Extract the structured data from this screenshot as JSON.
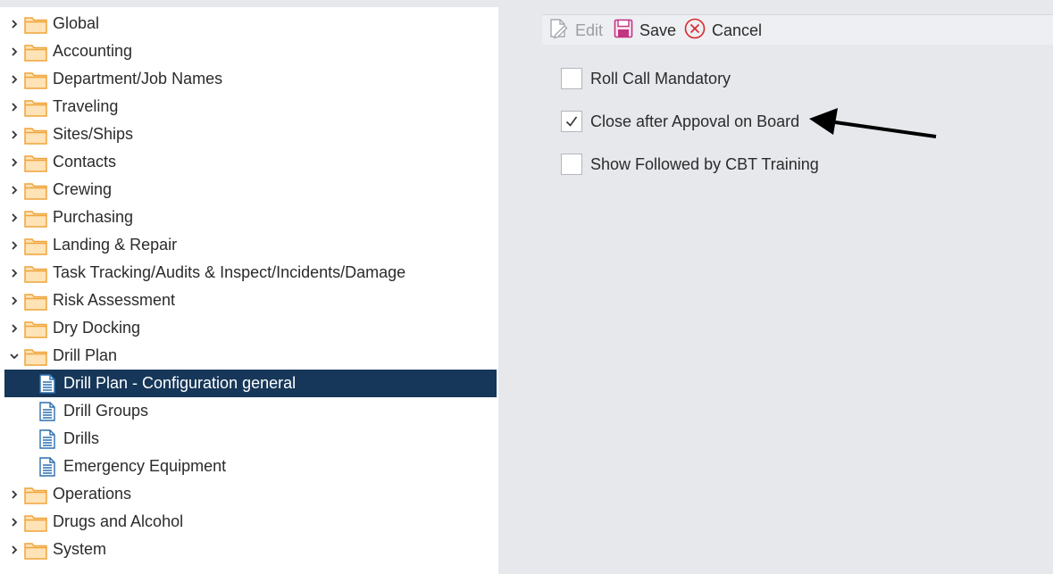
{
  "tree": {
    "items": [
      {
        "label": "Global",
        "type": "folder",
        "expanded": false,
        "level": 0
      },
      {
        "label": "Accounting",
        "type": "folder",
        "expanded": false,
        "level": 0
      },
      {
        "label": "Department/Job Names",
        "type": "folder",
        "expanded": false,
        "level": 0
      },
      {
        "label": "Traveling",
        "type": "folder",
        "expanded": false,
        "level": 0
      },
      {
        "label": "Sites/Ships",
        "type": "folder",
        "expanded": false,
        "level": 0
      },
      {
        "label": "Contacts",
        "type": "folder",
        "expanded": false,
        "level": 0
      },
      {
        "label": "Crewing",
        "type": "folder",
        "expanded": false,
        "level": 0
      },
      {
        "label": "Purchasing",
        "type": "folder",
        "expanded": false,
        "level": 0
      },
      {
        "label": "Landing & Repair",
        "type": "folder",
        "expanded": false,
        "level": 0
      },
      {
        "label": "Task Tracking/Audits & Inspect/Incidents/Damage",
        "type": "folder",
        "expanded": false,
        "level": 0
      },
      {
        "label": "Risk Assessment",
        "type": "folder",
        "expanded": false,
        "level": 0
      },
      {
        "label": "Dry Docking",
        "type": "folder",
        "expanded": false,
        "level": 0
      },
      {
        "label": "Drill Plan",
        "type": "folder",
        "expanded": true,
        "level": 0
      },
      {
        "label": "Drill Plan - Configuration general",
        "type": "document",
        "selected": true,
        "level": 1
      },
      {
        "label": "Drill Groups",
        "type": "document",
        "level": 1
      },
      {
        "label": "Drills",
        "type": "document",
        "level": 1
      },
      {
        "label": "Emergency Equipment",
        "type": "document",
        "level": 1
      },
      {
        "label": "Operations",
        "type": "folder",
        "expanded": false,
        "level": 0
      },
      {
        "label": "Drugs and Alcohol",
        "type": "folder",
        "expanded": false,
        "level": 0
      },
      {
        "label": "System",
        "type": "folder",
        "expanded": false,
        "level": 0
      }
    ]
  },
  "toolbar": {
    "edit_label": "Edit",
    "save_label": "Save",
    "cancel_label": "Cancel"
  },
  "options": [
    {
      "label": "Roll Call Mandatory",
      "checked": false
    },
    {
      "label": "Close after Appoval on Board",
      "checked": true
    },
    {
      "label": "Show Followed by CBT Training",
      "checked": false
    }
  ],
  "colors": {
    "selected_row": "#163759",
    "folder": "#f0a43a",
    "folder_fill": "#fde3b6",
    "document": "#2d6fae",
    "save_icon": "#c2357f",
    "cancel_icon": "#d8262d",
    "background": "#e6e8ec"
  },
  "icons": {
    "folder": "folder-icon",
    "document": "document-icon",
    "edit": "pencil-page-icon",
    "save": "floppy-disk-icon",
    "cancel": "circle-x-icon",
    "annotation": "arrow-icon"
  }
}
